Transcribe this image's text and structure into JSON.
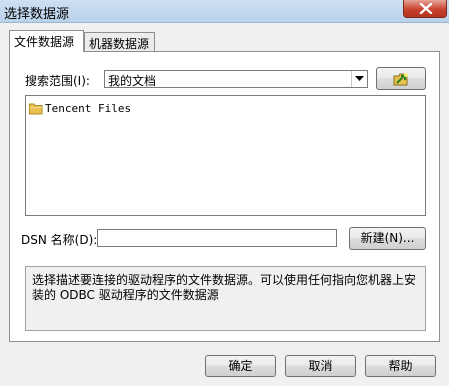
{
  "window": {
    "title": "选择数据源"
  },
  "tabs": [
    {
      "label": "文件数据源",
      "active": true
    },
    {
      "label": "机器数据源",
      "active": false
    }
  ],
  "search": {
    "label": "搜索范围(I):",
    "value": "我的文档"
  },
  "files": [
    {
      "name": "Tencent Files",
      "icon": "folder-icon"
    }
  ],
  "dsn": {
    "label": "DSN 名称(D):",
    "value": "",
    "new_button": "新建(N)..."
  },
  "description": "选择描述要连接的驱动程序的文件数据源。可以使用任何指向您机器上安装的 ODBC 驱动程序的文件数据源",
  "buttons": {
    "ok": "确定",
    "cancel": "取消",
    "help": "帮助"
  },
  "colors": {
    "titlebar": "#b9d1ea",
    "close": "#c7432e",
    "folder": "#e8c24f"
  }
}
